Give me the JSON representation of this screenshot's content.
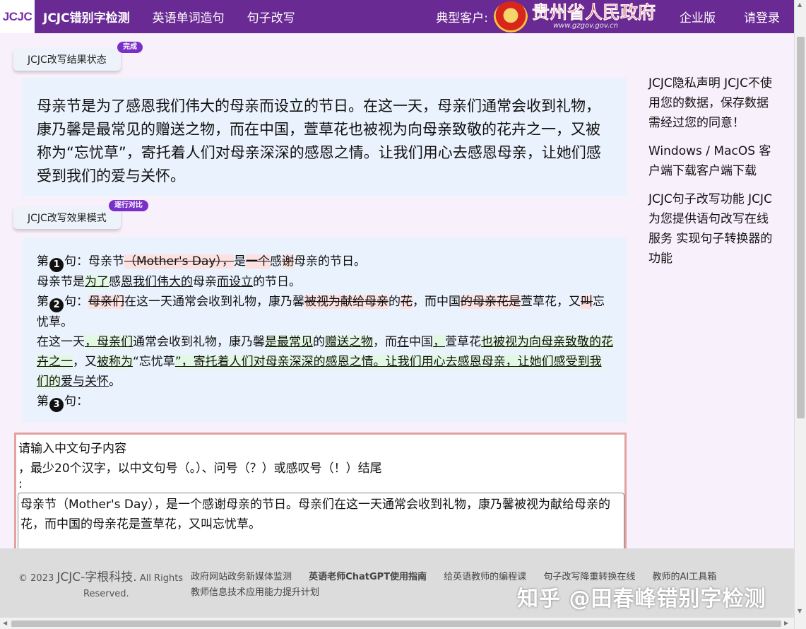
{
  "nav": {
    "logo": "JCJC",
    "brand": "JCJC错别字检测",
    "items": [
      "英语单词造句",
      "句子改写"
    ],
    "clients_label": "典型客户:",
    "gov_name": "贵州省人民政府",
    "gov_url": "www.gzgov.gov.cn",
    "enterprise": "企业版",
    "login": "请登录"
  },
  "result": {
    "tab_label": "JCJC改写结果状态",
    "badge": "完成",
    "text": "母亲节是为了感恩我们伟大的母亲而设立的节日。在这一天，母亲们通常会收到礼物，康乃馨是最常见的赠送之物，而在中国，萱草花也被视为向母亲致敬的花卉之一，又被称为“忘忧草”，寄托着人们对母亲深深的感恩之情。让我们用心去感恩母亲，让她们感受到我们的爱与关怀。"
  },
  "compare": {
    "tab_label": "JCJC改写效果模式",
    "badge": "逐行对比",
    "sentence_prefix": "第",
    "sentence_suffix": "句：",
    "s1": {
      "num": "1",
      "orig": [
        {
          "t": "母亲节",
          "k": "n"
        },
        {
          "t": "（Mother's Day），",
          "k": "d"
        },
        {
          "t": "是",
          "k": "n"
        },
        {
          "t": "一个",
          "k": "d"
        },
        {
          "t": "感",
          "k": "n"
        },
        {
          "t": "谢",
          "k": "d"
        },
        {
          "t": "母亲的节日。",
          "k": "n"
        }
      ],
      "new": [
        {
          "t": "母亲节是",
          "k": "n"
        },
        {
          "t": "为了",
          "k": "i"
        },
        {
          "t": "感",
          "k": "n"
        },
        {
          "t": "恩我们伟大的",
          "k": "u"
        },
        {
          "t": "母亲",
          "k": "n"
        },
        {
          "t": "而设立",
          "k": "u"
        },
        {
          "t": "的节日。",
          "k": "n"
        }
      ]
    },
    "s2": {
      "num": "2",
      "orig": [
        {
          "t": "母亲们",
          "k": "d"
        },
        {
          "t": "在这一天通常会收到礼物，康乃馨",
          "k": "n"
        },
        {
          "t": "被视为献给母亲",
          "k": "d"
        },
        {
          "t": "的",
          "k": "n"
        },
        {
          "t": "花",
          "k": "d"
        },
        {
          "t": "，而中国",
          "k": "n"
        },
        {
          "t": "的母亲花是",
          "k": "d"
        },
        {
          "t": "萱草花，又",
          "k": "n"
        },
        {
          "t": "叫",
          "k": "d"
        },
        {
          "t": "忘忧草。",
          "k": "n"
        }
      ],
      "new": [
        {
          "t": "在这一天",
          "k": "n"
        },
        {
          "t": "，母亲们",
          "k": "i"
        },
        {
          "t": "通常会收到礼物，康乃馨",
          "k": "n"
        },
        {
          "t": "是最常见",
          "k": "i"
        },
        {
          "t": "的",
          "k": "n"
        },
        {
          "t": "赠送之物",
          "k": "i"
        },
        {
          "t": "，而",
          "k": "n"
        },
        {
          "t": "在",
          "k": "u"
        },
        {
          "t": "中国",
          "k": "n"
        },
        {
          "t": "，",
          "k": "i"
        },
        {
          "t": "萱草花",
          "k": "n"
        },
        {
          "t": "也被视为向母亲致敬的花卉之一",
          "k": "i"
        },
        {
          "t": "，又",
          "k": "n"
        },
        {
          "t": "被称为",
          "k": "i"
        },
        {
          "t": "“忘忧草",
          "k": "n"
        },
        {
          "t": "”，寄托着人们对母亲深深的感恩之情。让我们用心去感恩母亲，让她们感受到我们的",
          "k": "i"
        },
        {
          "t": "爱与关怀",
          "k": "u"
        },
        {
          "t": "。",
          "k": "n"
        }
      ]
    },
    "s3": {
      "num": "3"
    }
  },
  "sidebar": {
    "privacy": "JCJC隐私声明 JCJC不使用您的数据，保存数据需经过您的同意！",
    "download": "Windows / MacOS 客户端下载客户端下载",
    "feature": "JCJC句子改写功能 JCJC为您提供语句改写在线服务 实现句子转换器的功能"
  },
  "input": {
    "label1": "请输入中文句子内容",
    "label2": "，最少20个汉字，以中文句号（。）、问号（？）或感叹号（！）结尾",
    "label3": ":",
    "value": "母亲节（Mother's Day），是一个感谢母亲的节日。母亲们在这一天通常会收到礼物，康乃馨被视为献给母亲的花，而中国的母亲花是萱草花，又叫忘忧草。"
  },
  "footer": {
    "copyright_line1": "© 2023",
    "company": "JCJC-字根科技.",
    "rights": "All Rights",
    "reserved": "Reserved.",
    "links": [
      "政府网站政务新媒体监测",
      "英语老师ChatGPT使用指南",
      "给英语教师的编程课",
      "句子改写降重转换在线",
      "教师的AI工具箱",
      "教师信息技术应用能力提升计划"
    ],
    "watermark": "知乎 @田春峰错别字检测"
  },
  "colors": {
    "nav_bg": "#6a2a93",
    "badge_bg": "#7a2fc9",
    "delete_bg": "#fde1e1",
    "insert_bg": "#e2f8e2",
    "input_border": "#e5a0a0"
  }
}
